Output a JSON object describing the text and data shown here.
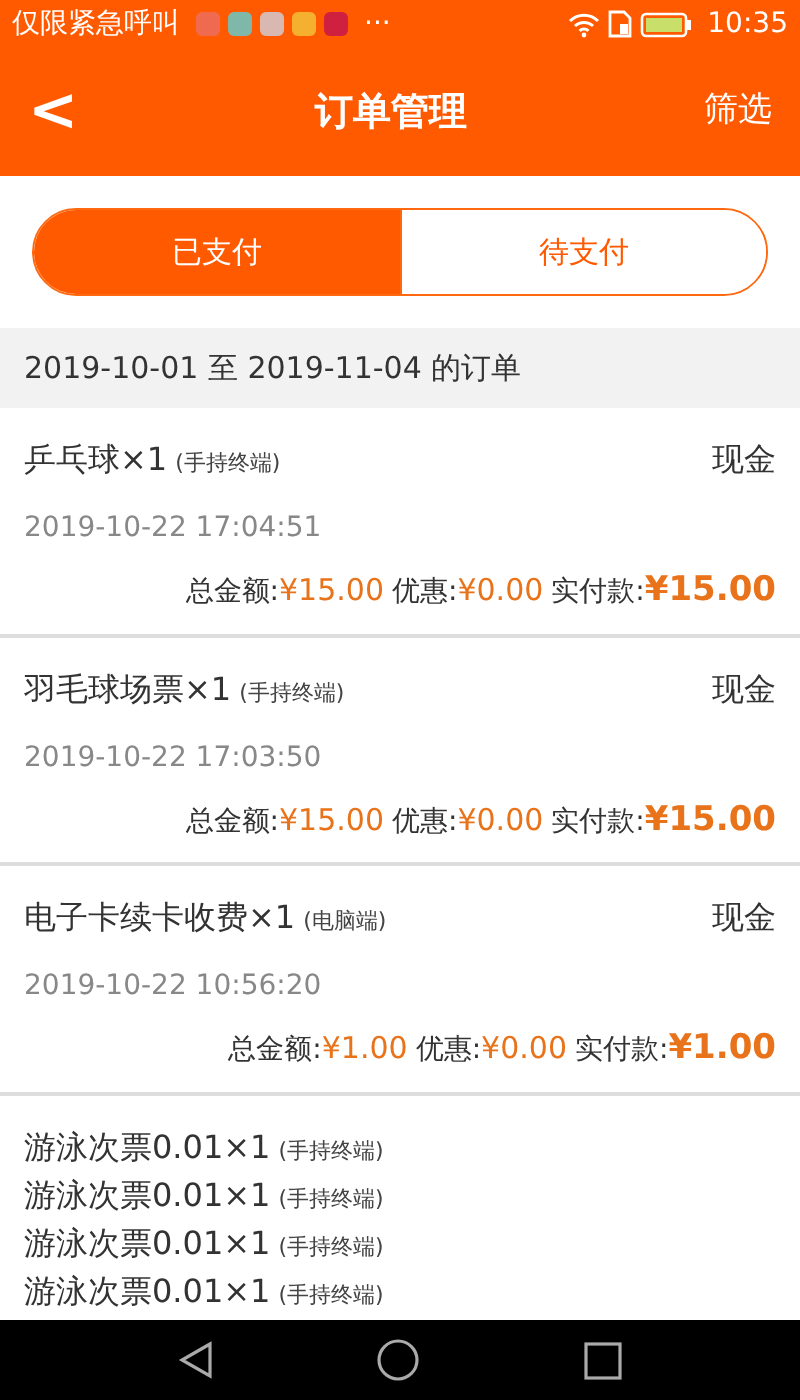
{
  "status_bar": {
    "carrier": "仅限紧急呼叫",
    "notifications": [
      {
        "color": "#f06a50"
      },
      {
        "color": "#7fb8a8"
      },
      {
        "color": "#d8b8b0"
      },
      {
        "color": "#f5b030"
      },
      {
        "color": "#d02040"
      }
    ],
    "more": "···",
    "time": "10:35"
  },
  "header": {
    "back": "<",
    "title": "订单管理",
    "action": "筛选"
  },
  "tabs": [
    {
      "label": "已支付",
      "selected": true
    },
    {
      "label": "待支付",
      "selected": false
    }
  ],
  "range": "2019-10-01 至 2019-11-04 的订单",
  "orders": [
    {
      "items": [
        {
          "name": "乒乓球×1",
          "source": "(手持终端)"
        }
      ],
      "payment": "现金",
      "time": "2019-10-22 17:04:51",
      "total_label": "总金额:",
      "total": "¥15.00",
      "discount_label": "优惠:",
      "discount": "¥0.00",
      "paid_label": "实付款:",
      "paid": "¥15.00"
    },
    {
      "items": [
        {
          "name": "羽毛球场票×1",
          "source": "(手持终端)"
        }
      ],
      "payment": "现金",
      "time": "2019-10-22 17:03:50",
      "total_label": "总金额:",
      "total": "¥15.00",
      "discount_label": "优惠:",
      "discount": "¥0.00",
      "paid_label": "实付款:",
      "paid": "¥15.00"
    },
    {
      "items": [
        {
          "name": "电子卡续卡收费×1",
          "source": "(电脑端)"
        }
      ],
      "payment": "现金",
      "time": "2019-10-22 10:56:20",
      "total_label": "总金额:",
      "total": "¥1.00",
      "discount_label": "优惠:",
      "discount": "¥0.00",
      "paid_label": "实付款:",
      "paid": "¥1.00"
    },
    {
      "items": [
        {
          "name": "游泳次票0.01×1",
          "source": "(手持终端)"
        },
        {
          "name": "游泳次票0.01×1",
          "source": "(手持终端)"
        },
        {
          "name": "游泳次票0.01×1",
          "source": "(手持终端)"
        },
        {
          "name": "游泳次票0.01×1",
          "source": "(手持终端)"
        }
      ]
    }
  ]
}
